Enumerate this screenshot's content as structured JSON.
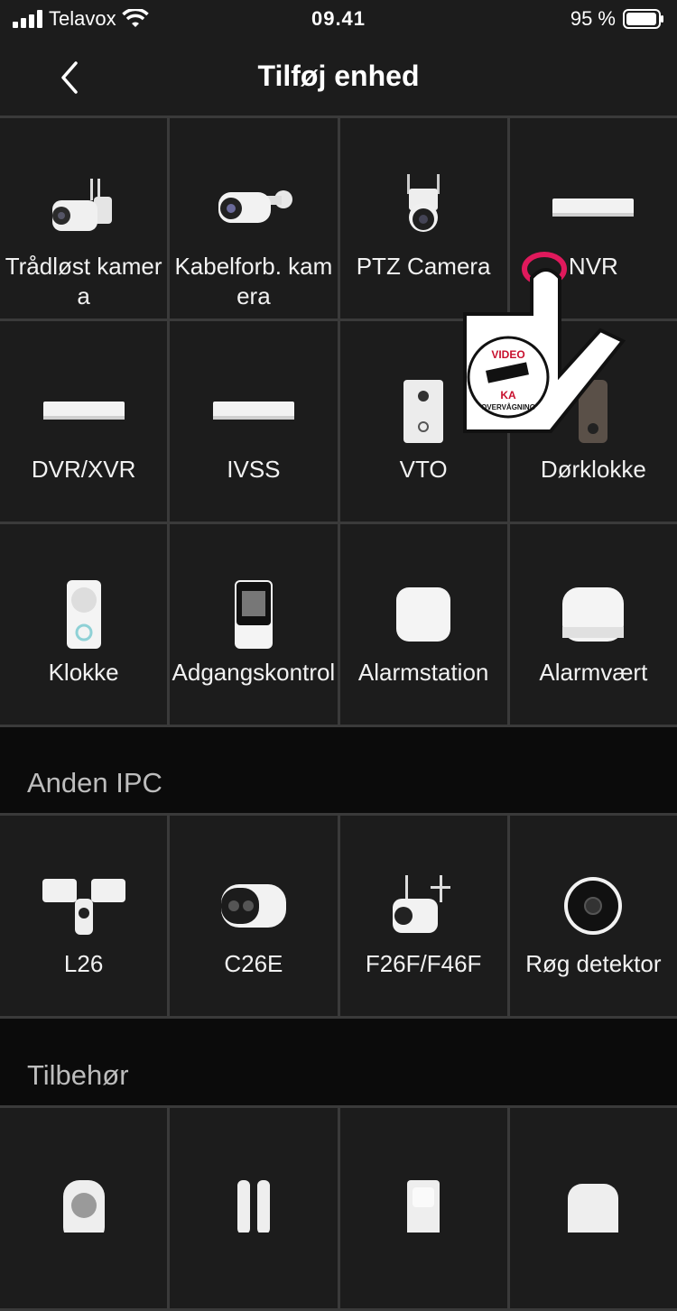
{
  "status": {
    "carrier": "Telavox",
    "time": "09.41",
    "battery": "95 %"
  },
  "nav": {
    "title": "Tilføj enhed"
  },
  "devices": [
    {
      "label": "Trådløst kamera",
      "icon": "wireless-camera-icon"
    },
    {
      "label": "Kabelforb. kamera",
      "icon": "wired-camera-icon"
    },
    {
      "label": "PTZ Camera",
      "icon": "ptz-camera-icon"
    },
    {
      "label": "NVR",
      "icon": "nvr-icon"
    },
    {
      "label": "DVR/XVR",
      "icon": "dvr-icon"
    },
    {
      "label": "IVSS",
      "icon": "ivss-icon"
    },
    {
      "label": "VTO",
      "icon": "vto-icon"
    },
    {
      "label": "Dørklokke",
      "icon": "doorbell-icon"
    },
    {
      "label": "Klokke",
      "icon": "chime-icon"
    },
    {
      "label": "Adgangskontrol",
      "icon": "access-control-icon"
    },
    {
      "label": "Alarmstation",
      "icon": "alarm-station-icon"
    },
    {
      "label": "Alarmvært",
      "icon": "alarm-hub-icon"
    }
  ],
  "section_other": {
    "title": "Anden IPC"
  },
  "other_ipc": [
    {
      "label": "L26",
      "icon": "floodlight-camera-icon"
    },
    {
      "label": "C26E",
      "icon": "c26e-camera-icon"
    },
    {
      "label": "F26F/F46F",
      "icon": "bullet-camera-icon"
    },
    {
      "label": "Røg detektor",
      "icon": "smoke-detector-icon"
    }
  ],
  "section_accessories": {
    "title": "Tilbehør"
  },
  "overlay": {
    "sign_top": "VIDEO",
    "sign_mid": "KA",
    "sign_bottom": "OVERVÅGNING"
  },
  "colors": {
    "bg": "#1c1c1c",
    "divider": "#3a3a3a",
    "section": "#0b0b0b"
  }
}
